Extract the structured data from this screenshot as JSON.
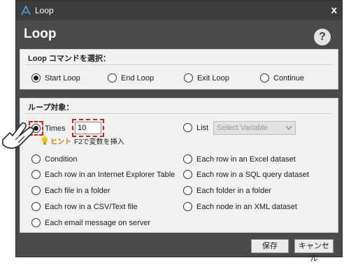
{
  "window": {
    "title": "Loop",
    "close_glyph": "x"
  },
  "heading": "Loop",
  "help_label": "?",
  "command_panel": {
    "title": "Loop コマンドを選択：",
    "options": [
      "Start Loop",
      "End Loop",
      "Exit Loop",
      "Continue"
    ],
    "selected": "Start Loop"
  },
  "target_panel": {
    "title": "ループ対象：",
    "times_label": "Times",
    "times_value": "10",
    "list_label": "List",
    "select_placeholder": "Select Variable",
    "hint_label": "ヒント",
    "hint_text": "F2で変数を挿入",
    "options_left": [
      "Condition",
      "Each row in an Internet Explorer Table",
      "Each file in a folder",
      "Each row in a CSV/Text file",
      "Each email message on server"
    ],
    "options_right": [
      "Each row in an Excel dataset",
      "Each row in a SQL query dataset",
      "Each folder in a folder",
      "Each node in an XML dataset"
    ],
    "selected": "Times"
  },
  "buttons": {
    "save": "保存",
    "cancel": "キャンセル"
  },
  "colors": {
    "window_bg": "#4a4a4a",
    "titlebar_bg": "#3c3c3c",
    "panel_bg": "#f2f2f2",
    "highlight_red": "#cc2222",
    "hint_orange": "#e07800"
  },
  "icons": [
    "app-logo-icon",
    "help-icon",
    "lightbulb-icon",
    "chevron-down-icon",
    "hand-pointer-icon"
  ]
}
